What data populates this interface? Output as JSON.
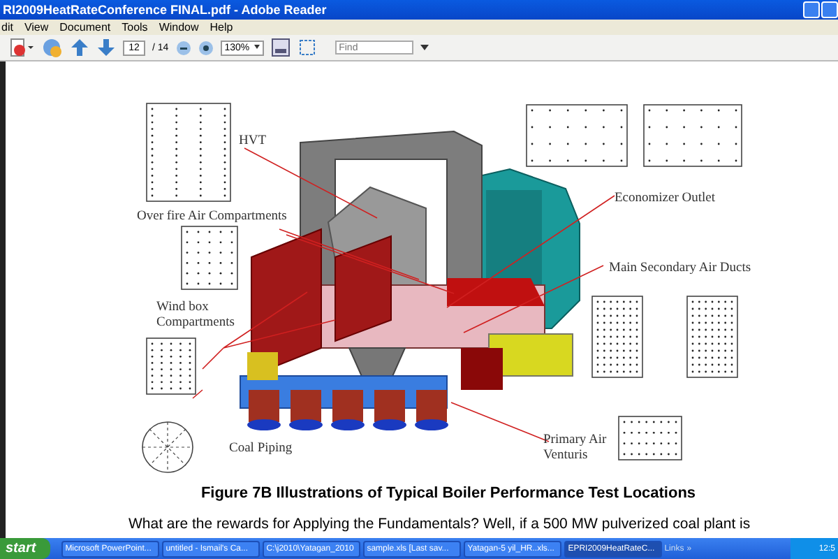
{
  "window": {
    "title": "RI2009HeatRateConference FINAL.pdf - Adobe Reader"
  },
  "menu_bar": [
    "dit",
    "View",
    "Document",
    "Tools",
    "Window",
    "Help"
  ],
  "toolbar": {
    "page": "12",
    "page_total": "/ 14",
    "zoom": "130%",
    "find": {
      "placeholder": "Find"
    }
  },
  "figure": {
    "labels": [
      "HVT",
      "Over fire Air Compartments",
      "Wind box Compartments",
      "Coal Piping",
      "Economizer Outlet",
      "Main Secondary Air Ducts",
      "Primary Air Venturis"
    ],
    "caption": "Figure 7B Illustrations of Typical Boiler Performance Test Locations"
  },
  "paragraph": "What are the rewards for Applying the Fundamentals?  Well, if a 500 MW pulverized coal plant is",
  "taskbar": {
    "start": "start",
    "items": [
      {
        "label": "Microsoft PowerPoint...",
        "selected": false
      },
      {
        "label": "untitled - Ismail's Ca...",
        "selected": false
      },
      {
        "label": "C:\\j2010\\Yatagan_2010",
        "selected": false
      },
      {
        "label": "sample.xls [Last sav...",
        "selected": false
      },
      {
        "label": "Yatagan-5 yil_HR..xls...",
        "selected": false
      },
      {
        "label": "EPRI2009HeatRateC...",
        "selected": true
      }
    ],
    "links": "Links",
    "chevron": "»",
    "clock": "12:5"
  }
}
